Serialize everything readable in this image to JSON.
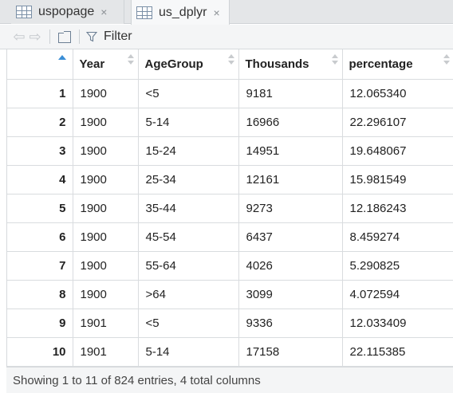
{
  "tabs": [
    {
      "label": "uspopage",
      "close": "×"
    },
    {
      "label": "us_dplyr",
      "close": "×"
    }
  ],
  "toolbar": {
    "filter_label": "Filter"
  },
  "table": {
    "columns": [
      "Year",
      "AgeGroup",
      "Thousands",
      "percentage"
    ],
    "rows": [
      {
        "n": "1",
        "Year": "1900",
        "AgeGroup": "<5",
        "Thousands": "9181",
        "percentage": "12.065340"
      },
      {
        "n": "2",
        "Year": "1900",
        "AgeGroup": "5-14",
        "Thousands": "16966",
        "percentage": "22.296107"
      },
      {
        "n": "3",
        "Year": "1900",
        "AgeGroup": "15-24",
        "Thousands": "14951",
        "percentage": "19.648067"
      },
      {
        "n": "4",
        "Year": "1900",
        "AgeGroup": "25-34",
        "Thousands": "12161",
        "percentage": "15.981549"
      },
      {
        "n": "5",
        "Year": "1900",
        "AgeGroup": "35-44",
        "Thousands": "9273",
        "percentage": "12.186243"
      },
      {
        "n": "6",
        "Year": "1900",
        "AgeGroup": "45-54",
        "Thousands": "6437",
        "percentage": "8.459274"
      },
      {
        "n": "7",
        "Year": "1900",
        "AgeGroup": "55-64",
        "Thousands": "4026",
        "percentage": "5.290825"
      },
      {
        "n": "8",
        "Year": "1900",
        "AgeGroup": ">64",
        "Thousands": "3099",
        "percentage": "4.072594"
      },
      {
        "n": "9",
        "Year": "1901",
        "AgeGroup": "<5",
        "Thousands": "9336",
        "percentage": "12.033409"
      },
      {
        "n": "10",
        "Year": "1901",
        "AgeGroup": "5-14",
        "Thousands": "17158",
        "percentage": "22.115385"
      }
    ]
  },
  "footer": {
    "status": "Showing 1 to 11 of 824 entries, 4 total columns"
  }
}
